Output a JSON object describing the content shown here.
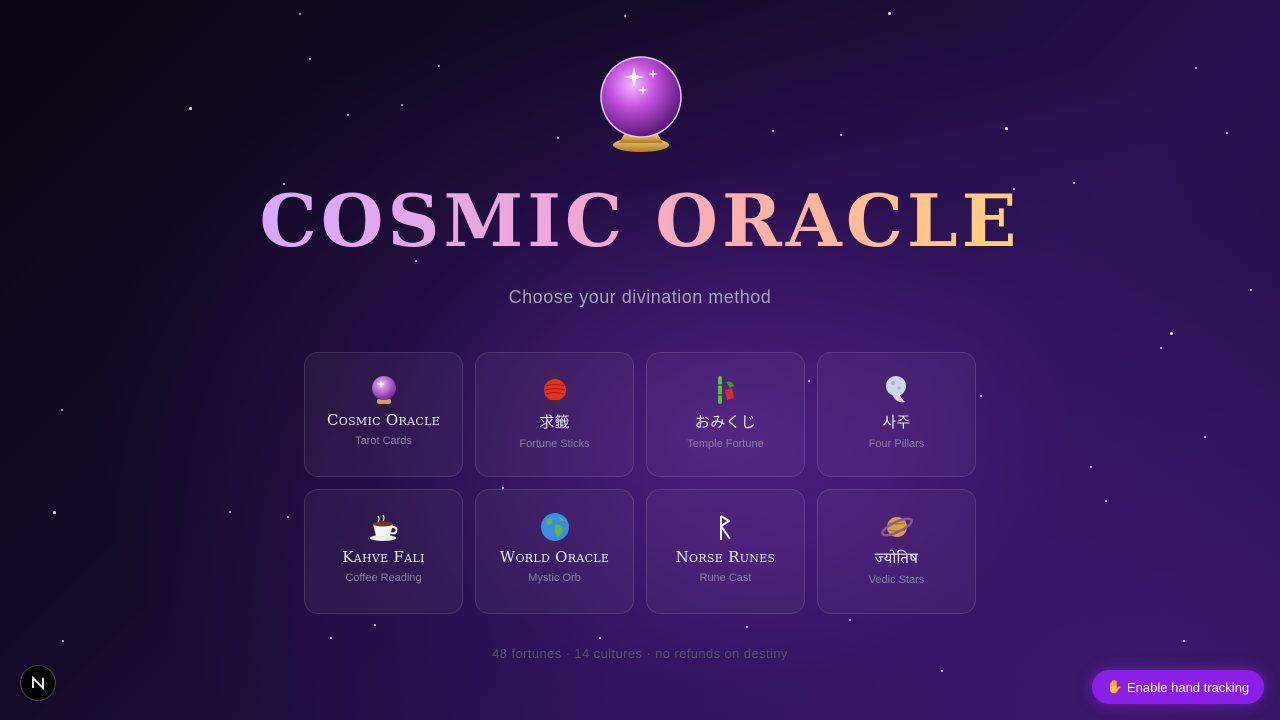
{
  "app": {
    "title": "COSMIC ORACLE",
    "subtitle": "Choose your divination method"
  },
  "methods": [
    {
      "name": "Cosmic Oracle",
      "sub": "Tarot Cards",
      "icon": "crystal-ball-icon"
    },
    {
      "name": "求籤",
      "sub": "Fortune Sticks",
      "icon": "red-lantern-icon"
    },
    {
      "name": "おみくじ",
      "sub": "Temple Fortune",
      "icon": "bamboo-fortune-icon"
    },
    {
      "name": "사주",
      "sub": "Four Pillars",
      "icon": "moon-viewing-icon"
    },
    {
      "name": "Kahve Falı",
      "sub": "Coffee Reading",
      "icon": "coffee-cup-icon"
    },
    {
      "name": "World Oracle",
      "sub": "Mystic Orb",
      "icon": "globe-icon"
    },
    {
      "name": "Norse Runes",
      "sub": "Rune Cast",
      "icon": "rune-icon"
    },
    {
      "name": "ज्योतिष",
      "sub": "Vedic Stars",
      "icon": "ringed-planet-icon"
    }
  ],
  "footer": "48 fortunes · 14 cultures · no refunds on destiny",
  "badge": "N",
  "hand_tracking": {
    "icon": "raised-hand-icon",
    "label": "Enable hand tracking"
  },
  "colors": {
    "accent": "#8b1fe6",
    "title_gradient": [
      "#d9a8ff",
      "#f0a6d8",
      "#ffb3a0",
      "#ffd27a"
    ]
  }
}
